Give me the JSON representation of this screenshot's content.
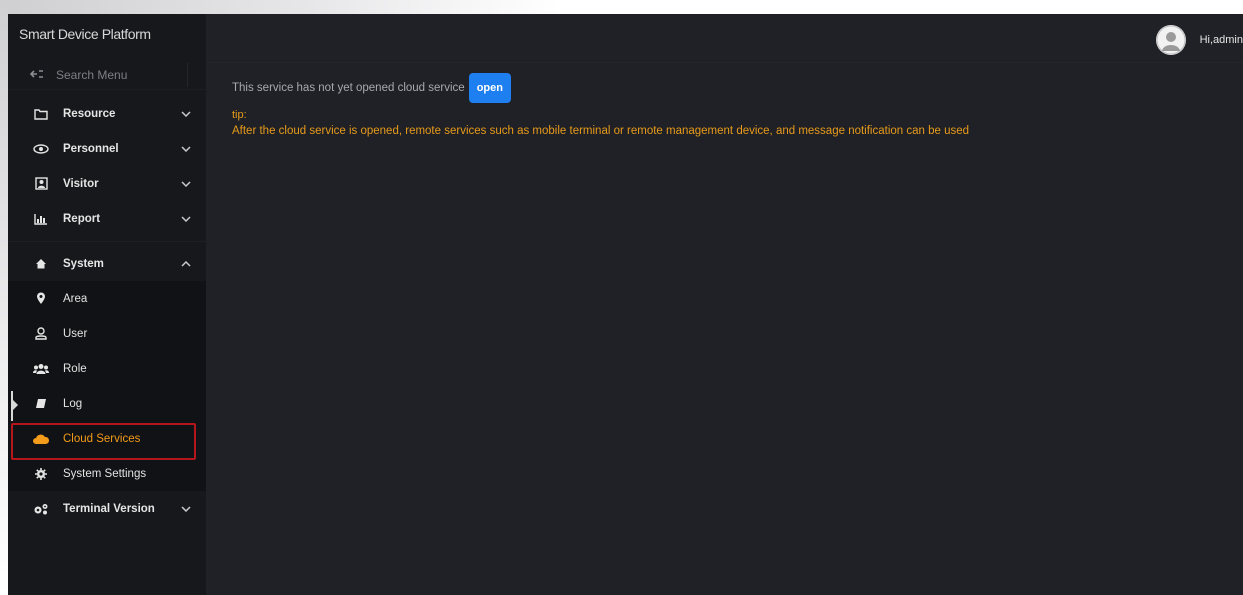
{
  "app": {
    "title": "Smart Device Platform",
    "user_greeting": "Hi,admin"
  },
  "search": {
    "placeholder": "Search Menu"
  },
  "sidebar": {
    "groups": [
      {
        "label": "Resource",
        "icon": "folder-icon",
        "expanded": false
      },
      {
        "label": "Personnel",
        "icon": "eye-icon",
        "expanded": false
      },
      {
        "label": "Visitor",
        "icon": "visitor-icon",
        "expanded": false
      },
      {
        "label": "Report",
        "icon": "bar-chart-icon",
        "expanded": false
      }
    ],
    "system": {
      "label": "System",
      "icon": "home-icon",
      "expanded": true,
      "items": [
        {
          "label": "Area",
          "icon": "map-pin-icon"
        },
        {
          "label": "User",
          "icon": "user-icon"
        },
        {
          "label": "Role",
          "icon": "users-icon"
        },
        {
          "label": "Log",
          "icon": "log-icon"
        },
        {
          "label": "Cloud Services",
          "icon": "cloud-icon",
          "active": true
        },
        {
          "label": "System Settings",
          "icon": "gear-icon"
        }
      ]
    },
    "terminal": {
      "label": "Terminal Version",
      "icon": "gears-icon",
      "expanded": false
    }
  },
  "main": {
    "notice": "This service has not yet opened cloud service",
    "open_button": "open",
    "tip_label": "tip:",
    "tip_text": "After the cloud service is opened, remote services such as mobile terminal or remote management device, and message notification can be used"
  },
  "colors": {
    "accent": "#1e7ff0",
    "active_text": "#f39b1a",
    "tip_text": "#e89a1a",
    "highlight_border": "#b5161b",
    "background": "#1f2126",
    "sidebar": "#17181c"
  }
}
